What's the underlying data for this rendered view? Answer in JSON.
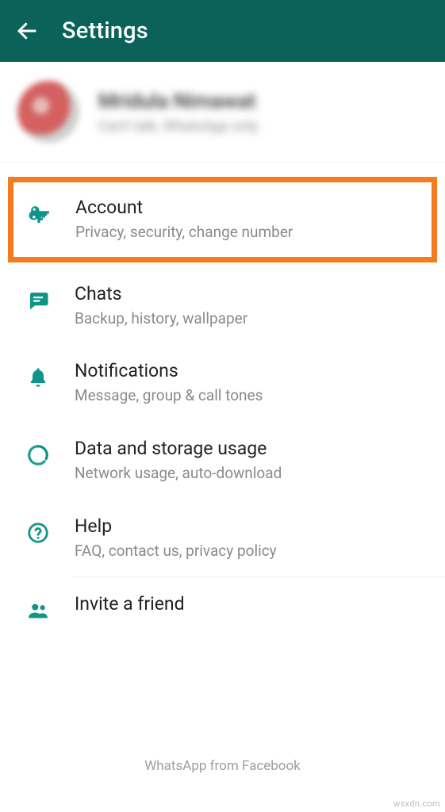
{
  "header": {
    "title": "Settings"
  },
  "profile": {
    "name": "Mridula Nimawat",
    "status": "Can't talk, WhatsApp only"
  },
  "items": {
    "account": {
      "title": "Account",
      "sub": "Privacy, security, change number"
    },
    "chats": {
      "title": "Chats",
      "sub": "Backup, history, wallpaper"
    },
    "notifications": {
      "title": "Notifications",
      "sub": "Message, group & call tones"
    },
    "data": {
      "title": "Data and storage usage",
      "sub": "Network usage, auto-download"
    },
    "help": {
      "title": "Help",
      "sub": "FAQ, contact us, privacy policy"
    },
    "invite": {
      "title": "Invite a friend"
    }
  },
  "footer": "WhatsApp from Facebook",
  "watermark": "wsxdn.com"
}
